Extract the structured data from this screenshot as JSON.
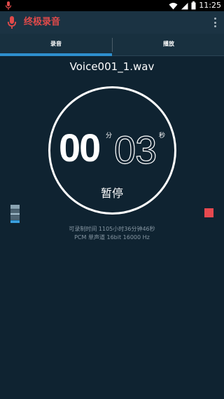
{
  "status_bar": {
    "time": "11:25",
    "icons": [
      "mic-icon",
      "wifi-icon",
      "signal-icon",
      "battery-icon"
    ],
    "mic_color": "#e04a4a"
  },
  "app_bar": {
    "title": "终极录音",
    "icon": "mic-icon",
    "menu_icon": "overflow-menu-icon",
    "accent_color": "#e04a4a"
  },
  "tabs": [
    {
      "label": "录音",
      "selected": true
    },
    {
      "label": "播放",
      "selected": false
    }
  ],
  "recording": {
    "filename": "Voice001_1.wav",
    "minutes": "00",
    "minutes_unit": "分",
    "seconds": "03",
    "seconds_unit": "秒",
    "state_label": "暂停",
    "remaining_time": "可录制时间 1105小时36分钟46秒",
    "format_info": "PCM 单声道 16bit 16000 Hz",
    "level_meter": {
      "segments": 12,
      "active_segments": 2
    },
    "stop_icon": "stop-icon",
    "stop_color": "#e6494f"
  },
  "colors": {
    "background": "#0f2331",
    "app_bar": "#1b3343",
    "tab_indicator": "#2e8fce"
  }
}
